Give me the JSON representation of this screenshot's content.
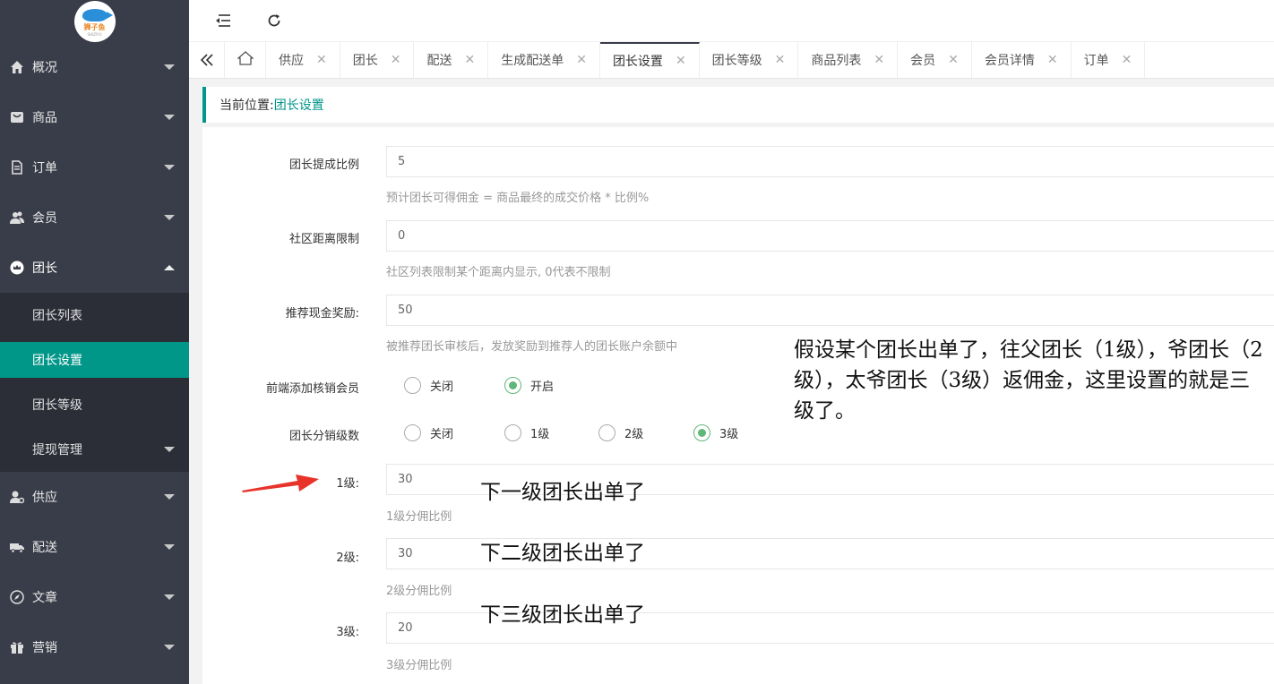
{
  "logo": {
    "brand": "狮子鱼",
    "sub": "SHIZIYU"
  },
  "sidebar": {
    "items": [
      {
        "label": "概况",
        "icon": "home-icon"
      },
      {
        "label": "商品",
        "icon": "shopping-bag-icon"
      },
      {
        "label": "订单",
        "icon": "document-icon"
      },
      {
        "label": "会员",
        "icon": "users-icon"
      },
      {
        "label": "团长",
        "icon": "crown-icon"
      }
    ],
    "sub_items": [
      {
        "label": "团长列表"
      },
      {
        "label": "团长设置"
      },
      {
        "label": "团长等级"
      },
      {
        "label": "提现管理"
      }
    ],
    "bottom_items": [
      {
        "label": "供应",
        "icon": "supplier-icon"
      },
      {
        "label": "配送",
        "icon": "truck-icon"
      },
      {
        "label": "文章",
        "icon": "compass-icon"
      },
      {
        "label": "营销",
        "icon": "gift-icon"
      }
    ]
  },
  "header": {
    "menu_icon": "collapse-menu-icon",
    "refresh_icon": "refresh-icon"
  },
  "tabs": [
    {
      "label": "供应"
    },
    {
      "label": "团长"
    },
    {
      "label": "配送"
    },
    {
      "label": "生成配送单"
    },
    {
      "label": "团长设置"
    },
    {
      "label": "团长等级"
    },
    {
      "label": "商品列表"
    },
    {
      "label": "会员"
    },
    {
      "label": "会员详情"
    },
    {
      "label": "订单"
    }
  ],
  "active_tab": "团长设置",
  "breadcrumb": {
    "prefix": "当前位置:",
    "current": "团长设置"
  },
  "form": {
    "commission_rate": {
      "label": "团长提成比例",
      "value": "5",
      "help": "预计团长可得佣金 = 商品最终的成交价格 * 比例%"
    },
    "distance_limit": {
      "label": "社区距离限制",
      "value": "0",
      "help": "社区列表限制某个距离内显示, 0代表不限制"
    },
    "referral_reward": {
      "label": "推荐现金奖励:",
      "value": "50",
      "help": "被推荐团长审核后，发放奖励到推荐人的团长账户余额中"
    },
    "frontend_verify": {
      "label": "前端添加核销会员",
      "options": [
        "关闭",
        "开启"
      ],
      "selected": "开启"
    },
    "distribution_levels": {
      "label": "团长分销级数",
      "options": [
        "关闭",
        "1级",
        "2级",
        "3级"
      ],
      "selected": "3级"
    },
    "level1": {
      "label": "1级:",
      "value": "30",
      "help": "1级分佣比例"
    },
    "level2": {
      "label": "2级:",
      "value": "30",
      "help": "2级分佣比例"
    },
    "level3": {
      "label": "3级:",
      "value": "20",
      "help": "3级分佣比例"
    }
  },
  "annotations": {
    "main": "假设某个团长出单了，往父团长（1级），爷团长（2级），太爷团长（3级）返佣金，这里设置的就是三级了。",
    "level1": "下一级团长出单了",
    "level2": "下二级团长出单了",
    "level3": "下三级团长出单了"
  },
  "colors": {
    "sidebar_bg": "#393d49",
    "accent": "#009688",
    "radio_on": "#5fb878",
    "arrow": "#e8332a"
  }
}
